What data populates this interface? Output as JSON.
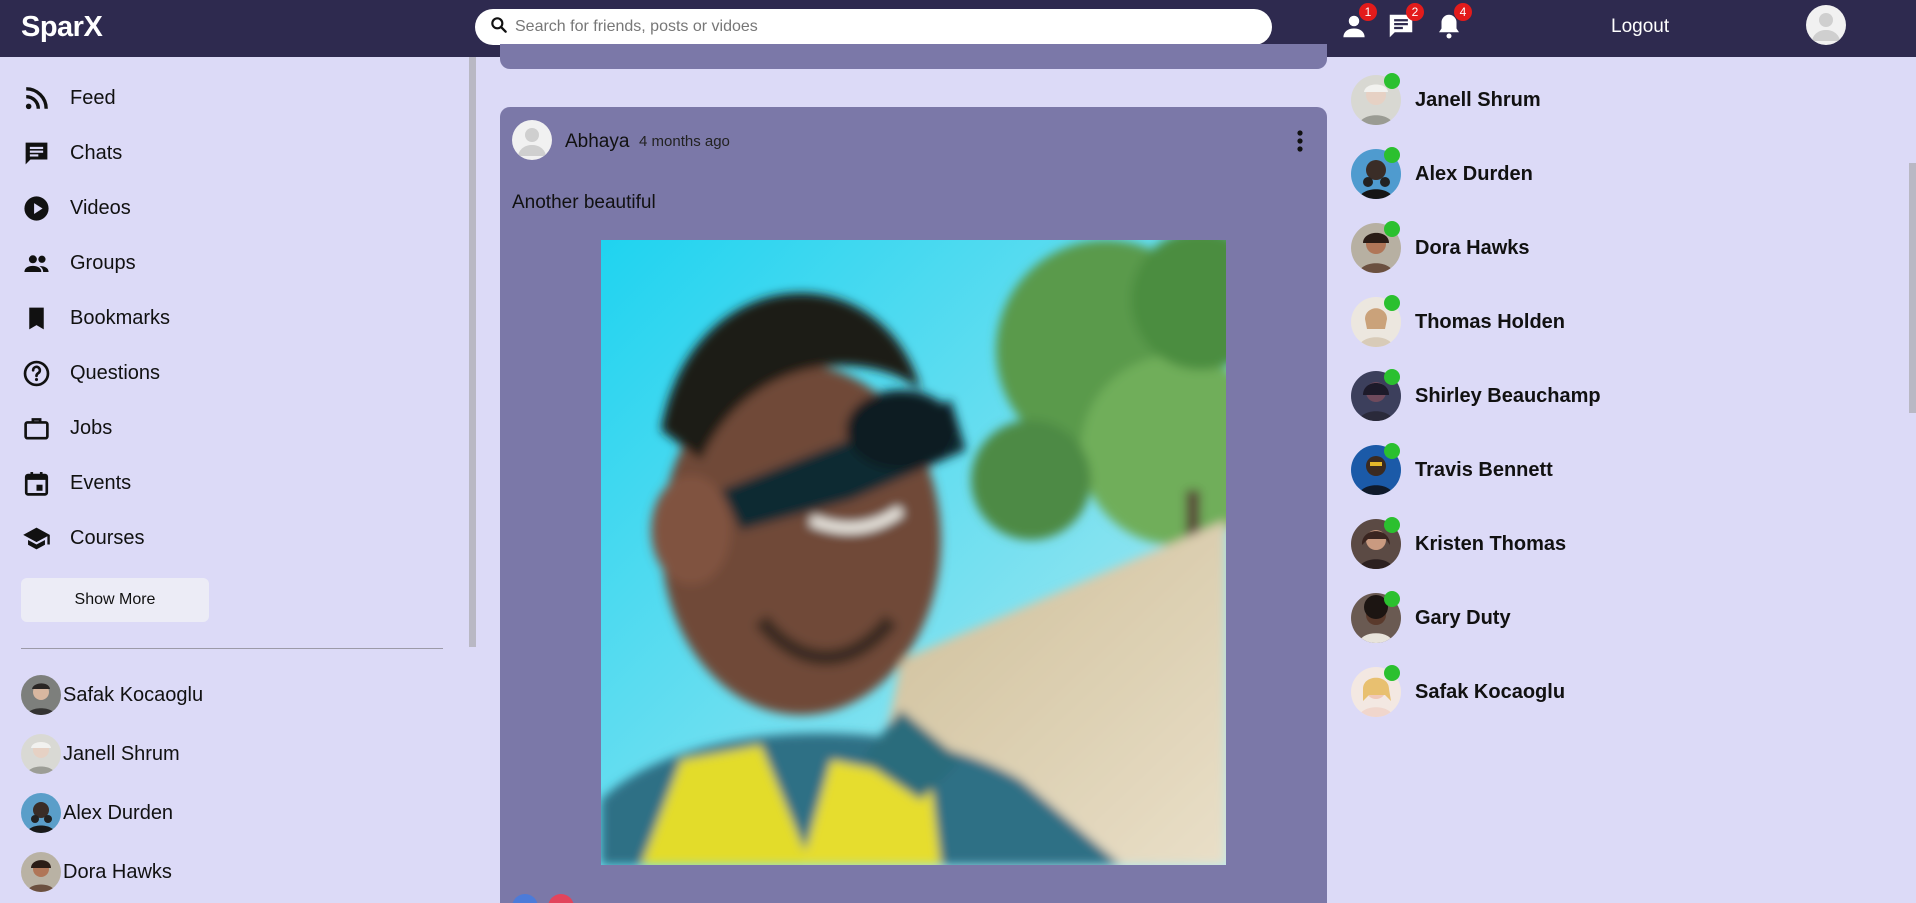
{
  "header": {
    "logo": "SparX",
    "search_placeholder": "Search for friends, posts or vidoes",
    "friend_requests_count": "1",
    "messages_count": "2",
    "notifications_count": "4",
    "logout_label": "Logout",
    "icons": [
      "search-icon",
      "person-icon",
      "chat-icon",
      "bell-icon",
      "user-avatar-icon"
    ]
  },
  "sidebar": {
    "nav": [
      {
        "label": "Feed",
        "icon": "rss-feed-icon"
      },
      {
        "label": "Chats",
        "icon": "chat-icon"
      },
      {
        "label": "Videos",
        "icon": "play-circle-icon"
      },
      {
        "label": "Groups",
        "icon": "group-icon"
      },
      {
        "label": "Bookmarks",
        "icon": "bookmark-icon"
      },
      {
        "label": "Questions",
        "icon": "help-circle-icon"
      },
      {
        "label": "Jobs",
        "icon": "briefcase-icon"
      },
      {
        "label": "Events",
        "icon": "calendar-event-icon"
      },
      {
        "label": "Courses",
        "icon": "school-icon"
      }
    ],
    "show_more_label": "Show More",
    "friends": [
      {
        "name": "Safak Kocaoglu"
      },
      {
        "name": "Janell Shrum"
      },
      {
        "name": "Alex Durden"
      },
      {
        "name": "Dora Hawks"
      }
    ]
  },
  "post": {
    "author": "Abhaya",
    "time": "4 months ago",
    "text": "Another beautiful",
    "menu_icon": "more-vertical-icon"
  },
  "online_friends": [
    {
      "name": "Janell Shrum"
    },
    {
      "name": "Alex Durden"
    },
    {
      "name": "Dora Hawks"
    },
    {
      "name": "Thomas Holden"
    },
    {
      "name": "Shirley Beauchamp"
    },
    {
      "name": "Travis Bennett"
    },
    {
      "name": "Kristen Thomas"
    },
    {
      "name": "Gary Duty"
    },
    {
      "name": "Safak Kocaoglu"
    }
  ],
  "colors": {
    "topbar": "#2e2a4f",
    "page_background": "#dcdaf7",
    "post_background": "#7b78a8",
    "badge": "#e31b1b",
    "online_dot": "#2bc02f"
  }
}
